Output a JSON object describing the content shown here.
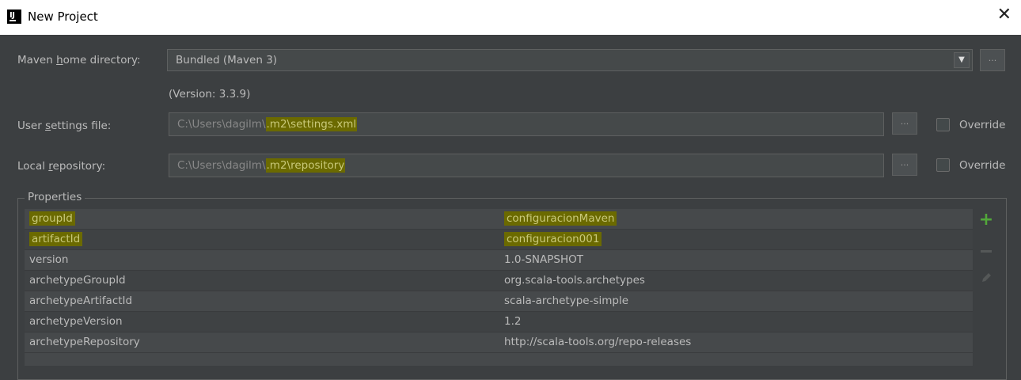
{
  "window": {
    "title": "New Project",
    "app_icon_text": "IJ"
  },
  "maven_home": {
    "label_prefix": "Maven ",
    "label_accel": "h",
    "label_suffix": "ome directory:",
    "value": "Bundled (Maven 3)",
    "version_text": "(Version: 3.3.9)"
  },
  "user_settings": {
    "label_prefix": "User ",
    "label_accel": "s",
    "label_suffix": "ettings file:",
    "value_plain": "C:\\Users\\dagilm\\",
    "value_highlight": ".m2\\settings.xml",
    "override_label": "Override",
    "override_checked": false
  },
  "local_repository": {
    "label_prefix": "Local ",
    "label_accel": "r",
    "label_suffix": "epository:",
    "value_plain": "C:\\Users\\dagilm\\",
    "value_highlight": ".m2\\repository",
    "override_label": "Override",
    "override_checked": false
  },
  "browse_button_label": "...",
  "properties": {
    "title": "Properties",
    "rows": [
      {
        "key": "groupId",
        "value": "configuracionMaven",
        "highlighted": true
      },
      {
        "key": "artifactId",
        "value": "configuracion001",
        "highlighted": true
      },
      {
        "key": "version",
        "value": "1.0-SNAPSHOT",
        "highlighted": false
      },
      {
        "key": "archetypeGroupId",
        "value": "org.scala-tools.archetypes",
        "highlighted": false
      },
      {
        "key": "archetypeArtifactId",
        "value": "scala-archetype-simple",
        "highlighted": false
      },
      {
        "key": "archetypeVersion",
        "value": "1.2",
        "highlighted": false
      },
      {
        "key": "archetypeRepository",
        "value": "http://scala-tools.org/repo-releases",
        "highlighted": false
      }
    ],
    "tools": [
      "plus-icon",
      "minus-icon",
      "pencil-icon"
    ]
  },
  "colors": {
    "background": "#3c3f41",
    "highlight": "#6b6a00",
    "add_icon": "#52a83a"
  }
}
